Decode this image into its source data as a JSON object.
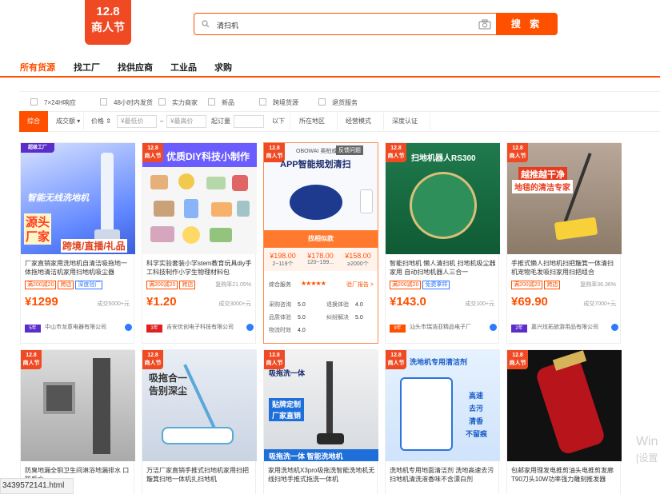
{
  "logo": {
    "line1": "12.8",
    "line2": "商人节"
  },
  "search": {
    "query": "清扫机",
    "button": "搜 索"
  },
  "nav": {
    "items": [
      "所有货源",
      "找工厂",
      "找供应商",
      "工业品",
      "求购"
    ]
  },
  "filters": [
    "7×24H响应",
    "48小时内发货",
    "实力商家",
    "新品",
    "跨境货源",
    "退货服务"
  ],
  "sort": {
    "items": [
      "综合",
      "成交额",
      "价格",
      "起订量",
      "所在地区",
      "经营模式",
      "深度认证"
    ],
    "price_min_placeholder": "¥最低价",
    "price_max_placeholder": "¥最高价",
    "dash": "–",
    "below": "以下"
  },
  "promo_tag": {
    "line1": "12.8",
    "line2": "商人节"
  },
  "products": [
    {
      "img_text": [
        "智能无线洗地机",
        "源头",
        "厂家",
        "跨境/直播/礼品"
      ],
      "corner": "超级工厂",
      "title": "厂家直销家用洗地机自清洁吸拖地一体拖地清洁机家用扫地机吸尘器",
      "badges": [
        "满200减20",
        "跨店",
        "深度验厂"
      ],
      "rate": "",
      "price_int": "1299",
      "price_dec": "",
      "sold": "成交5000+元",
      "years": "5年",
      "shop": "中山市龙意电器有限公司"
    },
    {
      "img_text": [
        "优质DIY科技小制作"
      ],
      "title": "科学实验套装小学stem教育玩具diy手工科技制作小学生物理材料包",
      "badges": [
        "满200减20",
        "跨店"
      ],
      "rate": "复购率21.05%",
      "price_int": "1",
      "price_dec": ".20",
      "sold": "成交3000+元",
      "years": "3年",
      "shop": "吉安优创电子科技有限公司"
    },
    {
      "img_text": [
        "扫地机器人RS300",
        "智能扫拖一体机Pro"
      ],
      "title": "智能扫地机 懒人清扫机 扫地机吸尘器家用 自动扫地机器人三合一",
      "badges": [
        "满200减20",
        "免费拿样"
      ],
      "rate": "",
      "price_int": "143",
      "price_dec": ".0",
      "sold": "成交100+元",
      "years": "9年",
      "shop": "汕头市瑞浩亚精品电子厂"
    },
    {
      "img_text": [
        "越推越干净",
        "地毯的清洁专家"
      ],
      "title": "手推式懒人扫地机扫把簸箕一体清扫机宠物毛发吸扫家用扫把组合",
      "badges": [
        "满200减20",
        "跨店"
      ],
      "rate": "复购率36.36%",
      "price_int": "69",
      "price_dec": ".90",
      "sold": "成交7000+元",
      "years": "2年",
      "shop": "嘉兴炫拓旅游用品有限公司"
    },
    {
      "img_text": [],
      "title": "防臭地漏全铜卫生间淋浴地漏排水 口防反水",
      "price_int": "",
      "sold": ""
    },
    {
      "img_text": [
        "吸拖合一",
        "告别深尘"
      ],
      "title": "万洁厂家直销手推式扫地机家用扫把簸箕扫地一体机扎扫地机",
      "price_int": "",
      "sold": ""
    },
    {
      "img_text": [
        "吸拖洗一体",
        "贴牌定制",
        "厂家直销",
        "吸拖洗一体 智能洗地机"
      ],
      "title": "家用洗地机X3pro吸拖洗智能洗地机无线扫地手推式拖洗一体机",
      "price_int": "",
      "sold": ""
    },
    {
      "img_text": [
        "洗地机专用清洁剂",
        "高速",
        "去污",
        "清香",
        "不留痕"
      ],
      "title": "洗地机专用地面清洁剂 洗地高速去污扫地机清洗液香味不含漂白剂",
      "price_int": "",
      "sold": ""
    },
    {
      "img_text": [],
      "title": "包邮家用理发电推剪油头电推剪发廊T90刀头10W功率强力雕刻推发器",
      "price_int": "",
      "sold": ""
    }
  ],
  "feature_card": {
    "img_text": [
      "OBOWAI 奥柏威",
      "APP智能规划清扫",
      "反馈问题"
    ],
    "find_label": "找相似款",
    "prices": [
      {
        "price": "¥198.00",
        "qty": "2~119个"
      },
      {
        "price": "¥178.00",
        "qty": "120~199..."
      },
      {
        "price": "¥158.00",
        "qty": "≥2000个"
      }
    ],
    "service_label": "综合服务",
    "stars": "★★★★★",
    "report_label": "验厂报告 >",
    "metrics": [
      {
        "label": "采购咨询",
        "value": "5.0"
      },
      {
        "label": "退换体验",
        "value": "4.0"
      },
      {
        "label": "品质体验",
        "value": "5.0"
      },
      {
        "label": "纠纷解决",
        "value": "5.0"
      },
      {
        "label": "物流时效",
        "value": "4.0"
      }
    ]
  },
  "status": {
    "filename": "3439572141.html"
  },
  "watermark": {
    "line1": "Win",
    "line2": "[设置"
  },
  "colors": {
    "accent": "#ff5000",
    "brand_red": "#ef4a23",
    "link_blue": "#2e7bff"
  }
}
